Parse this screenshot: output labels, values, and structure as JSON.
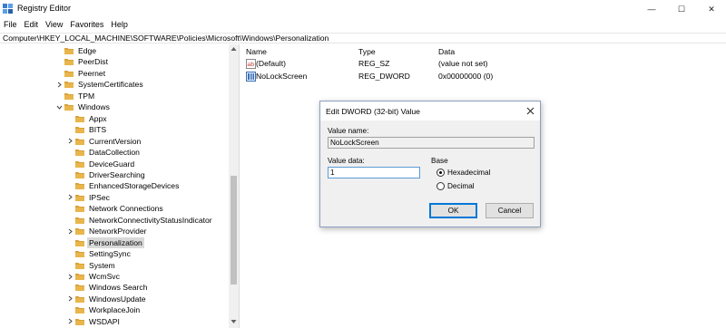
{
  "window": {
    "title": "Registry Editor",
    "minimize_glyph": "—",
    "maximize_glyph": "☐",
    "close_glyph": "✕"
  },
  "menu": [
    "File",
    "Edit",
    "View",
    "Favorites",
    "Help"
  ],
  "address": "Computer\\HKEY_LOCAL_MACHINE\\SOFTWARE\\Policies\\Microsoft\\Windows\\Personalization",
  "tree": [
    {
      "label": "Edge",
      "expandable": false,
      "depth": 1
    },
    {
      "label": "PeerDist",
      "expandable": false,
      "depth": 1
    },
    {
      "label": "Peernet",
      "expandable": false,
      "depth": 1
    },
    {
      "label": "SystemCertificates",
      "expandable": true,
      "depth": 1
    },
    {
      "label": "TPM",
      "expandable": false,
      "depth": 1
    },
    {
      "label": "Windows",
      "expandable": true,
      "expanded": true,
      "depth": 1
    },
    {
      "label": "Appx",
      "expandable": false,
      "depth": 2
    },
    {
      "label": "BITS",
      "expandable": false,
      "depth": 2
    },
    {
      "label": "CurrentVersion",
      "expandable": true,
      "depth": 2
    },
    {
      "label": "DataCollection",
      "expandable": false,
      "depth": 2
    },
    {
      "label": "DeviceGuard",
      "expandable": false,
      "depth": 2
    },
    {
      "label": "DriverSearching",
      "expandable": false,
      "depth": 2
    },
    {
      "label": "EnhancedStorageDevices",
      "expandable": false,
      "depth": 2
    },
    {
      "label": "IPSec",
      "expandable": true,
      "depth": 2
    },
    {
      "label": "Network Connections",
      "expandable": false,
      "depth": 2
    },
    {
      "label": "NetworkConnectivityStatusIndicator",
      "expandable": false,
      "depth": 2
    },
    {
      "label": "NetworkProvider",
      "expandable": true,
      "depth": 2
    },
    {
      "label": "Personalization",
      "expandable": false,
      "depth": 2,
      "selected": true
    },
    {
      "label": "SettingSync",
      "expandable": false,
      "depth": 2
    },
    {
      "label": "System",
      "expandable": false,
      "depth": 2
    },
    {
      "label": "WcmSvc",
      "expandable": true,
      "depth": 2
    },
    {
      "label": "Windows Search",
      "expandable": false,
      "depth": 2
    },
    {
      "label": "WindowsUpdate",
      "expandable": true,
      "depth": 2
    },
    {
      "label": "WorkplaceJoin",
      "expandable": false,
      "depth": 2
    },
    {
      "label": "WSDAPI",
      "expandable": true,
      "depth": 2
    }
  ],
  "list": {
    "columns": {
      "name": "Name",
      "type": "Type",
      "data": "Data"
    },
    "rows": [
      {
        "name": "(Default)",
        "type": "REG_SZ",
        "data": "(value not set)",
        "icon": "string-value-icon"
      },
      {
        "name": "NoLockScreen",
        "type": "REG_DWORD",
        "data": "0x00000000 (0)",
        "icon": "binary-value-icon"
      }
    ]
  },
  "dialog": {
    "title": "Edit DWORD (32-bit) Value",
    "value_name_label": "Value name:",
    "value_name": "NoLockScreen",
    "value_data_label": "Value data:",
    "value_data": "1",
    "base_label": "Base",
    "base_options": [
      {
        "label": "Hexadecimal",
        "checked": true
      },
      {
        "label": "Decimal",
        "checked": false
      }
    ],
    "ok": "OK",
    "cancel": "Cancel"
  },
  "colors": {
    "folder": "#e8b64c",
    "folder_dark": "#d9a23a",
    "selection": "#d9d9d9",
    "accent": "#0078d7"
  }
}
